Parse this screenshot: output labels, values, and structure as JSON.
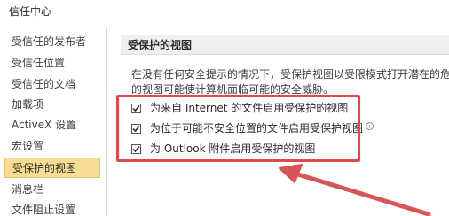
{
  "window": {
    "title": "信任中心"
  },
  "sidebar": {
    "items": [
      {
        "label": "受信任的发布者"
      },
      {
        "label": "受信任位置"
      },
      {
        "label": "受信任的文档"
      },
      {
        "label": "加载项"
      },
      {
        "label": "ActiveX 设置"
      },
      {
        "label": "宏设置"
      },
      {
        "label": "受保护的视图"
      },
      {
        "label": "消息栏"
      },
      {
        "label": "文件阻止设置"
      }
    ],
    "selected_index": 6
  },
  "main": {
    "section_title": "受保护的视图",
    "description_line1": "在没有任何安全提示的情况下，受保护视图以受限模式打开潜在的危险文件",
    "description_line2": "的视图可能使计算机面临可能的安全威胁。",
    "options": [
      {
        "label": "为来自 Internet 的文件启用受保护的视图",
        "checked": true,
        "info": false
      },
      {
        "label": "为位于可能不安全位置的文件启用受保护视图",
        "checked": true,
        "info": true
      },
      {
        "label": "为 Outlook 附件启用受保护的视图",
        "checked": true,
        "info": false
      }
    ]
  },
  "annotation": {
    "highlight_color": "#e04a4a",
    "arrow_color": "#d95555"
  }
}
